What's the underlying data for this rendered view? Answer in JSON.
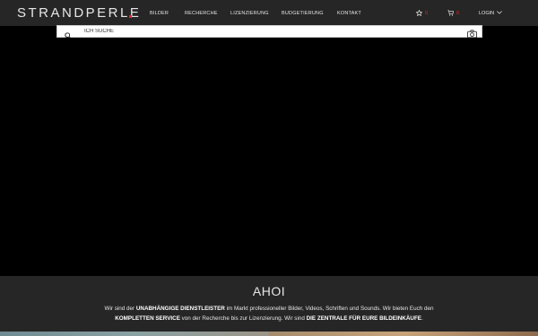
{
  "brand": {
    "logo": "STRANDPERLE"
  },
  "nav": {
    "items": [
      {
        "label": "BILDER"
      },
      {
        "label": "RECHERCHE"
      },
      {
        "label": "LIZENZIERUNG"
      },
      {
        "label": "BUDGETIERUNG"
      },
      {
        "label": "KONTAKT"
      }
    ]
  },
  "header": {
    "favorites_count": "0",
    "cart_count": "0",
    "login_label": "LOGIN"
  },
  "search": {
    "placeholder": "ICH SUCHE"
  },
  "intro": {
    "title": "AHOI",
    "line1_a": "Wir sind der ",
    "line1_b": "UNABHÄNGIGE DIENSTLEISTER",
    "line1_c": " im Markt professioneller Bilder, Videos, Schriften und Sounds. Wir bieten Euch den",
    "line2_a": "KOMPLETTEN SERVICE",
    "line2_b": " von der Recherche bis zur Lizenzierung. Wir sind ",
    "line2_c": "DIE ZENTRALE FÜR EURE BILDEINKÄUFE",
    "line2_d": "."
  },
  "colors": {
    "accent": "#e3262f",
    "bar": "#262626",
    "background": "#000000"
  }
}
